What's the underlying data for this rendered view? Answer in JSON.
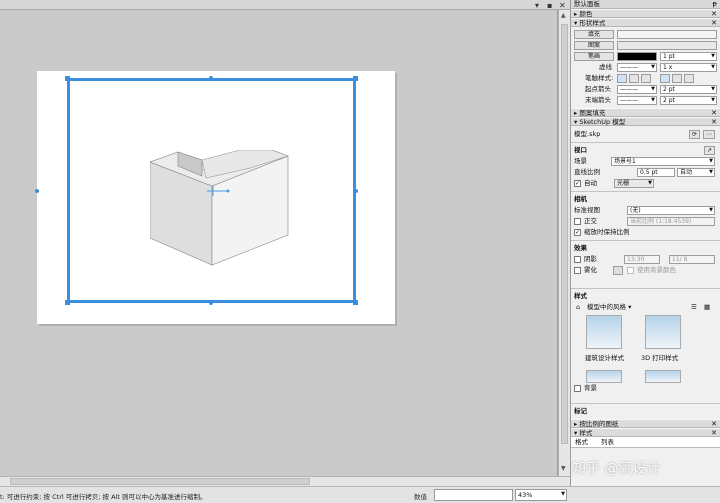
{
  "canvas": {
    "top_controls": [
      "▾",
      "▪",
      "✕"
    ]
  },
  "status": {
    "hint": "t: 可进行约束; 按 Ctrl 可进行拷贝; 按 Alt 则可以中心为基准进行缩制。",
    "measure_label": "数值",
    "zoom": "43%"
  },
  "panel": {
    "tray_title": "默认面板",
    "sections": {
      "colors": "颜色",
      "shape_style": "形状样式",
      "pattern_fill": "图案填充",
      "sketchup_model": "SketchUp 模型",
      "scaled_drawing": "按比例的图纸",
      "style_tab": "样式"
    },
    "shape_style": {
      "fill_btn": "填充",
      "pattern_btn": "图案",
      "stroke_btn": "笔画",
      "stroke_width": "1 pt",
      "dash_label": "虚线",
      "dash_value": "1 x",
      "stroke_style_label": "笔触样式:",
      "start_arrow_label": "起点箭头",
      "start_arrow_size": "2 pt",
      "end_arrow_label": "末端箭头",
      "end_arrow_size": "2 pt"
    },
    "model": {
      "file": "模型.skp",
      "viewport_title": "视口",
      "scene_label": "场景",
      "scene_value": "场景号1",
      "line_scale_label": "直线比例",
      "line_scale_value": "0.5 pt",
      "line_scale_mode": "自动",
      "auto_label": "自动",
      "auto_checked": true,
      "render_mode": "光栅",
      "camera_title": "相机",
      "std_view_label": "标准视图",
      "std_view_value": "(无)",
      "ortho_label": "正交",
      "ortho_checked": false,
      "current_scale": "当前比例 (1:18.4539)",
      "preserve_scale_label": "缩放时保持比例",
      "preserve_scale_checked": true,
      "effects_title": "效果",
      "shadow_label": "阴影",
      "shadow_time": "13:30",
      "shadow_date": "11/ 8",
      "fog_label": "雾化",
      "use_bg_color": "使用背景颜色"
    },
    "styles": {
      "title": "样式",
      "source": "模型中的风格",
      "items": [
        "建筑设计样式",
        "3D 打印样式"
      ],
      "background_label": "背景",
      "tags_title": "标记"
    },
    "bottom_tabs": [
      "格式",
      "列表"
    ]
  },
  "watermark": "知乎 @氧设计"
}
